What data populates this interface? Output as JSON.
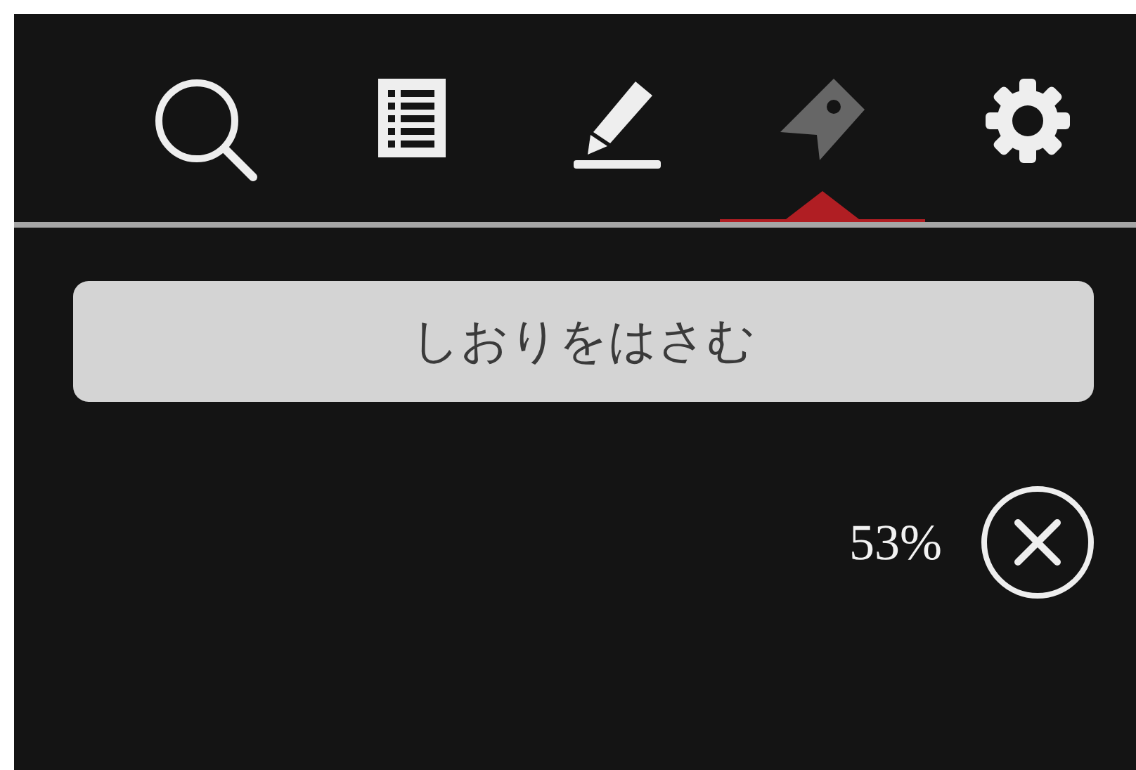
{
  "toolbar": {
    "tabs": [
      {
        "kind": "search",
        "selected": false
      },
      {
        "kind": "contents",
        "selected": false
      },
      {
        "kind": "highlight",
        "selected": false
      },
      {
        "kind": "bookmark",
        "selected": true
      },
      {
        "kind": "settings",
        "selected": false
      }
    ]
  },
  "bookmark_button": {
    "label": "しおりをはさむ"
  },
  "progress": {
    "reading": "53%"
  }
}
